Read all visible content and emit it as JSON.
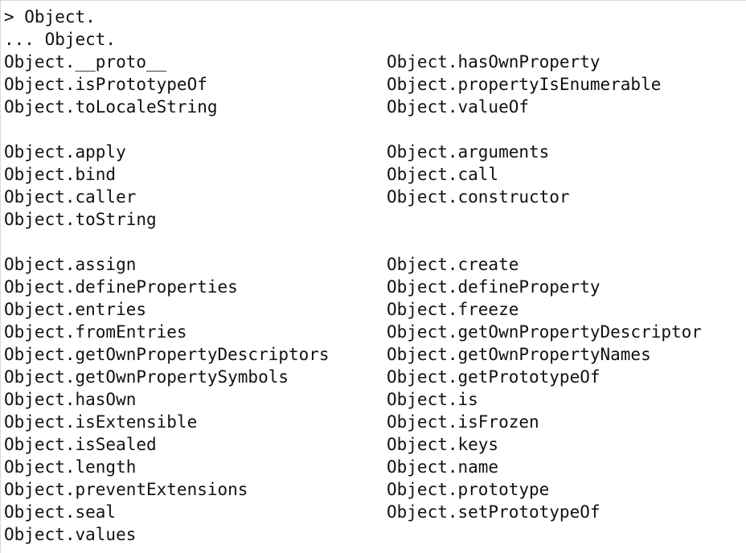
{
  "prompt": {
    "input_line": "> Object.",
    "continuation_line": "... Object."
  },
  "completions": {
    "group1": [
      {
        "left": "Object.__proto__",
        "right": "Object.hasOwnProperty"
      },
      {
        "left": "Object.isPrototypeOf",
        "right": "Object.propertyIsEnumerable"
      },
      {
        "left": "Object.toLocaleString",
        "right": "Object.valueOf"
      }
    ],
    "group2": [
      {
        "left": "Object.apply",
        "right": "Object.arguments"
      },
      {
        "left": "Object.bind",
        "right": "Object.call"
      },
      {
        "left": "Object.caller",
        "right": "Object.constructor"
      },
      {
        "left": "Object.toString",
        "right": ""
      }
    ],
    "group3": [
      {
        "left": "Object.assign",
        "right": "Object.create"
      },
      {
        "left": "Object.defineProperties",
        "right": "Object.defineProperty"
      },
      {
        "left": "Object.entries",
        "right": "Object.freeze"
      },
      {
        "left": "Object.fromEntries",
        "right": "Object.getOwnPropertyDescriptor"
      },
      {
        "left": "Object.getOwnPropertyDescriptors",
        "right": "Object.getOwnPropertyNames"
      },
      {
        "left": "Object.getOwnPropertySymbols",
        "right": "Object.getPrototypeOf"
      },
      {
        "left": "Object.hasOwn",
        "right": "Object.is"
      },
      {
        "left": "Object.isExtensible",
        "right": "Object.isFrozen"
      },
      {
        "left": "Object.isSealed",
        "right": "Object.keys"
      },
      {
        "left": "Object.length",
        "right": "Object.name"
      },
      {
        "left": "Object.preventExtensions",
        "right": "Object.prototype"
      },
      {
        "left": "Object.seal",
        "right": "Object.setPrototypeOf"
      },
      {
        "left": "Object.values",
        "right": ""
      }
    ]
  }
}
